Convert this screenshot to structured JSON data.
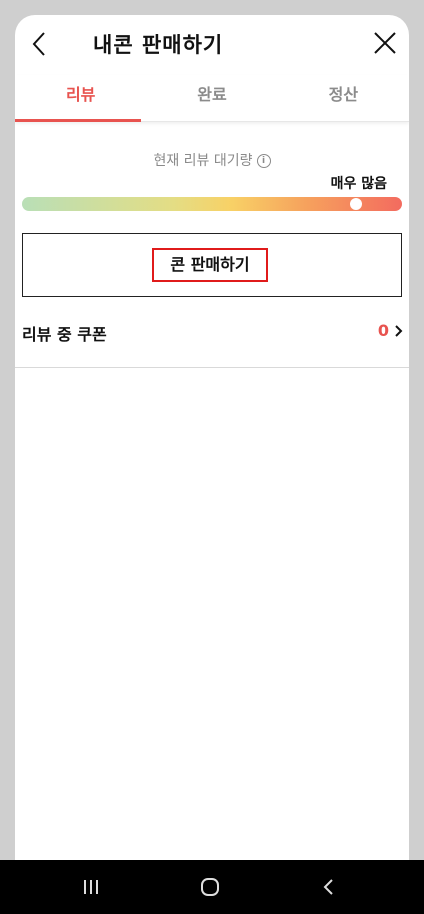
{
  "header": {
    "title": "내콘 판매하기",
    "back_icon": "chevron-left-icon",
    "close_icon": "close-icon"
  },
  "tabs": [
    {
      "label": "리뷰",
      "active": true
    },
    {
      "label": "완료",
      "active": false
    },
    {
      "label": "정산",
      "active": false
    }
  ],
  "wait_status": {
    "label": "현재 리뷰 대기량",
    "info_icon": "info-icon",
    "level_text": "매우 많음",
    "level_fraction": 0.88,
    "gradient_colors": [
      "#b9dfb7",
      "#f8d166",
      "#f36b5f"
    ]
  },
  "sell_button": {
    "label": "콘 판매하기",
    "border_color": "#e01b1b"
  },
  "review_coupons": {
    "label": "리뷰 중 쿠폰",
    "count": "0"
  },
  "colors": {
    "accent": "#e8534f"
  },
  "system_nav": {
    "icons": [
      "recent-apps-icon",
      "home-icon",
      "back-icon"
    ]
  }
}
